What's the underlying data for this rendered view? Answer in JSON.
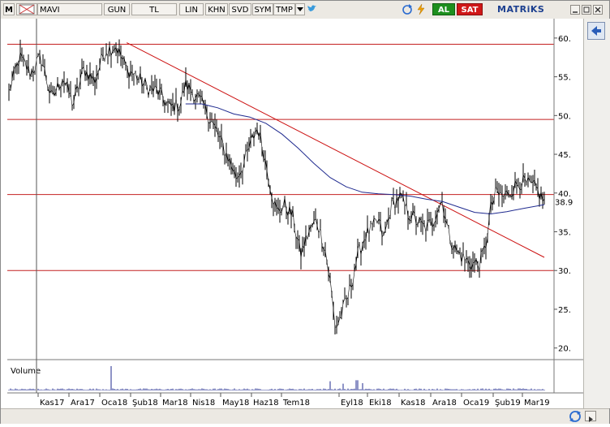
{
  "toolbar": {
    "menu_icon": "M",
    "symbol": "MAVI",
    "period": "GUN",
    "currency": "TL",
    "buttons": [
      "LIN",
      "KHN",
      "SVD",
      "SYM",
      "TMP"
    ],
    "buy_label": "AL",
    "sell_label": "SAT",
    "brand": "MATRiKS",
    "icons": [
      "grid-icon",
      "chevron-down-icon",
      "twitter-bird-icon",
      "refresh-icon",
      "lightning-icon",
      "minimize-icon",
      "maximize-icon",
      "close-icon"
    ]
  },
  "chart_data": {
    "type": "line",
    "subtype": "price-bar-ohlc",
    "symbol": "MAVI",
    "period": "daily",
    "x_tick_labels": [
      "Kas17",
      "Ara17",
      "Oca18",
      "Şub18",
      "Mar18",
      "Nis18",
      "May18",
      "Haz18",
      "Tem18",
      "Eyl18",
      "Eki18",
      "Kas18",
      "Ara18",
      "Oca19",
      "Şub19",
      "Mar19"
    ],
    "y_tick_labels": [
      "60.",
      "55.",
      "50.",
      "45.",
      "40.",
      "35.",
      "30.",
      "25.",
      "20."
    ],
    "ylim": [
      18.5,
      62.5
    ],
    "last_price_label": "38.9",
    "last_price": 38.9,
    "grid": false,
    "series": [
      {
        "name": "",
        "kind": "price",
        "color": "#000000",
        "points": [
          [
            0.0,
            53.0
          ],
          [
            0.02,
            57.5
          ],
          [
            0.04,
            55.5
          ],
          [
            0.06,
            57.5
          ],
          [
            0.08,
            52.0
          ],
          [
            0.1,
            55.0
          ],
          [
            0.12,
            51.5
          ],
          [
            0.14,
            56.0
          ],
          [
            0.16,
            54.5
          ],
          [
            0.18,
            58.5
          ],
          [
            0.2,
            59.0
          ],
          [
            0.22,
            56.0
          ],
          [
            0.24,
            55.0
          ],
          [
            0.26,
            53.5
          ],
          [
            0.28,
            53.0
          ],
          [
            0.3,
            51.0
          ],
          [
            0.32,
            51.5
          ],
          [
            0.33,
            54.0
          ],
          [
            0.35,
            52.5
          ],
          [
            0.37,
            50.5
          ],
          [
            0.39,
            47.5
          ],
          [
            0.41,
            44.5
          ],
          [
            0.425,
            42.0
          ],
          [
            0.44,
            44.0
          ],
          [
            0.455,
            47.0
          ],
          [
            0.465,
            48.5
          ],
          [
            0.475,
            45.5
          ],
          [
            0.49,
            40.5
          ],
          [
            0.5,
            37.5
          ],
          [
            0.515,
            38.5
          ],
          [
            0.53,
            37.0
          ],
          [
            0.545,
            32.0
          ],
          [
            0.56,
            35.0
          ],
          [
            0.575,
            36.5
          ],
          [
            0.59,
            33.0
          ],
          [
            0.6,
            28.5
          ],
          [
            0.61,
            22.5
          ],
          [
            0.62,
            24.0
          ],
          [
            0.635,
            27.0
          ],
          [
            0.65,
            31.5
          ],
          [
            0.665,
            34.5
          ],
          [
            0.68,
            35.5
          ],
          [
            0.69,
            36.5
          ],
          [
            0.7,
            34.0
          ],
          [
            0.715,
            38.5
          ],
          [
            0.73,
            39.5
          ],
          [
            0.745,
            37.5
          ],
          [
            0.76,
            36.5
          ],
          [
            0.775,
            35.5
          ],
          [
            0.79,
            36.0
          ],
          [
            0.8,
            38.0
          ],
          [
            0.81,
            39.0
          ],
          [
            0.82,
            35.0
          ],
          [
            0.835,
            32.5
          ],
          [
            0.85,
            31.5
          ],
          [
            0.865,
            30.8
          ],
          [
            0.88,
            31.0
          ],
          [
            0.89,
            33.0
          ],
          [
            0.9,
            38.0
          ],
          [
            0.91,
            40.0
          ],
          [
            0.925,
            39.5
          ],
          [
            0.94,
            40.5
          ],
          [
            0.955,
            41.5
          ],
          [
            0.97,
            41.0
          ],
          [
            0.985,
            40.5
          ],
          [
            1.0,
            38.9
          ]
        ]
      },
      {
        "name": "",
        "kind": "moving-average",
        "color": "#1f2a8f",
        "points": [
          [
            0.33,
            51.5
          ],
          [
            0.36,
            51.5
          ],
          [
            0.39,
            51.0
          ],
          [
            0.42,
            50.2
          ],
          [
            0.45,
            49.8
          ],
          [
            0.48,
            49.0
          ],
          [
            0.51,
            47.6
          ],
          [
            0.54,
            45.8
          ],
          [
            0.57,
            43.8
          ],
          [
            0.6,
            42.0
          ],
          [
            0.63,
            40.8
          ],
          [
            0.66,
            40.1
          ],
          [
            0.69,
            39.9
          ],
          [
            0.72,
            39.8
          ],
          [
            0.75,
            39.6
          ],
          [
            0.78,
            39.2
          ],
          [
            0.81,
            38.9
          ],
          [
            0.84,
            38.2
          ],
          [
            0.87,
            37.5
          ],
          [
            0.9,
            37.3
          ],
          [
            0.93,
            37.6
          ],
          [
            0.96,
            38.0
          ],
          [
            1.0,
            38.5
          ]
        ]
      }
    ],
    "horizontal_levels": [
      59.2,
      49.5,
      39.8,
      30.0
    ],
    "trendline": {
      "start": [
        0.22,
        59.4
      ],
      "end": [
        1.0,
        31.7
      ],
      "color": "#cc1111"
    },
    "volume": {
      "label": "Volume",
      "spikes": [
        [
          0.19,
          1.0
        ],
        [
          0.6,
          0.38
        ],
        [
          0.65,
          0.42
        ],
        [
          0.625,
          0.28
        ],
        [
          0.66,
          0.3
        ]
      ],
      "baseline_level": 0.06
    }
  }
}
